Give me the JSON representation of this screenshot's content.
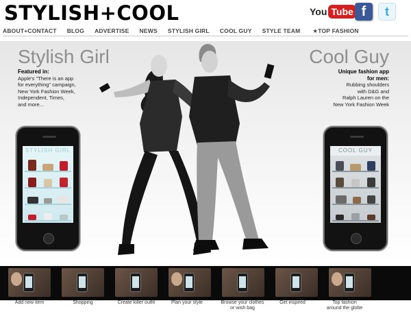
{
  "header": {
    "logo": "STYLISH+COOL",
    "social": {
      "youtube_you": "You",
      "youtube_tube": "Tube",
      "facebook": "f",
      "twitter": "t"
    }
  },
  "nav": {
    "items": [
      {
        "label": "ABOUT+CONTACT"
      },
      {
        "label": "BLOG"
      },
      {
        "label": "ADVERTISE"
      },
      {
        "label": "NEWS"
      },
      {
        "label": "STYLISH GIRL"
      },
      {
        "label": "COOL GUY"
      },
      {
        "label": "STYLE TEAM"
      },
      {
        "label": "★TOP FASHION"
      }
    ]
  },
  "hero": {
    "left": {
      "title": "Stylish Girl",
      "heading": "Featured in:",
      "lines": [
        "Apple's \"There is an app",
        "for everything\" campaign,",
        "New York Fashion Week,",
        "Independent, Times,",
        "and more..."
      ],
      "phone_screen_title": "STYLISH GIRL"
    },
    "right": {
      "title": "Cool Guy",
      "heading_1": "Unique fashion app",
      "heading_2": "for men:",
      "lines": [
        "Rubbing shoulders",
        "with D&G and",
        "Ralph Lauren on the",
        "New York Fashion Week"
      ],
      "phone_screen_title": "COOL GUY"
    }
  },
  "thumbnails": [
    {
      "caption_1": "Add new item",
      "caption_2": ""
    },
    {
      "caption_1": "Shopping",
      "caption_2": ""
    },
    {
      "caption_1": "Create killer outfit",
      "caption_2": ""
    },
    {
      "caption_1": "Plan your style",
      "caption_2": ""
    },
    {
      "caption_1": "Browse your clothes",
      "caption_2": "or wish bag"
    },
    {
      "caption_1": "Get inspired",
      "caption_2": ""
    },
    {
      "caption_1": "Top fashion",
      "caption_2": "around the globe"
    }
  ],
  "colors": {
    "youtube_red": "#d4201e",
    "facebook_blue": "#3b5998",
    "twitter_blue": "#3fa9d7",
    "title_gray": "#8e8e8e"
  }
}
